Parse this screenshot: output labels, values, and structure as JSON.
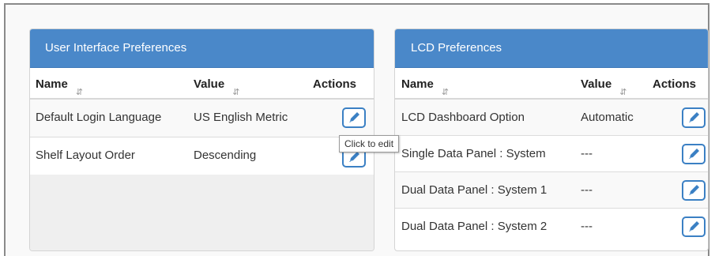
{
  "ui_panel": {
    "title": "User Interface Preferences",
    "columns": {
      "name": "Name",
      "value": "Value",
      "actions": "Actions"
    },
    "rows": [
      {
        "name": "Default Login Language",
        "value": "US English Metric"
      },
      {
        "name": "Shelf Layout Order",
        "value": "Descending"
      }
    ]
  },
  "lcd_panel": {
    "title": "LCD Preferences",
    "columns": {
      "name": "Name",
      "value": "Value",
      "actions": "Actions"
    },
    "rows": [
      {
        "name": "LCD Dashboard Option",
        "value": "Automatic"
      },
      {
        "name": "Single Data Panel : System",
        "value": "---"
      },
      {
        "name": "Dual Data Panel : System 1",
        "value": "---"
      },
      {
        "name": "Dual Data Panel : System 2",
        "value": "---"
      }
    ]
  },
  "tooltip": {
    "text": "Click to edit"
  },
  "icons": {
    "sort": "sort-icon",
    "edit": "edit-pencil-icon"
  },
  "colors": {
    "header_bg": "#4a88c9",
    "edit_border": "#3b80c4"
  }
}
